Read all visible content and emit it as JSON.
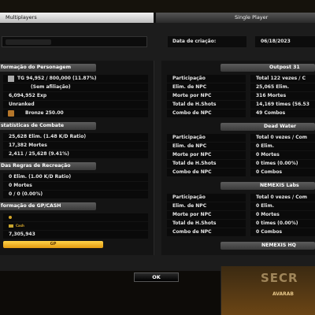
{
  "tabs": {
    "multiplayers": "Multiplayers",
    "single_player": "Single Player"
  },
  "profile": {
    "date_label": "Data de criação:",
    "date_value": "06/18/2023"
  },
  "personagem": {
    "title": "formação do Personagem",
    "rank_text": "TG  94,952 / 800,000 (11.87%)",
    "affiliation": "(Sem afiliação)",
    "exp": "6,094,952 Exp",
    "ranked": "Unranked",
    "bronze": "Bronze 250.00"
  },
  "combate": {
    "title": "statísticas de Combate",
    "rows": [
      "25,628 Elim. (1.48 K/D Ratio)",
      "17,382 Mortes",
      "2,411 / 25,628 (9.41%)"
    ]
  },
  "recreacao": {
    "title": "Das Regras de Recreação",
    "rows": [
      "0 Elim. (1.00 K/D Ratio)",
      "0 Mortes",
      "0 / 0 (0.00%)"
    ]
  },
  "gpcash": {
    "title": "formação de GP/CASH",
    "cash_label": "Cash",
    "gp": "7,305,943",
    "button": "GP"
  },
  "maps": [
    {
      "title": "Outpost 31",
      "rows": [
        {
          "label": "Participação",
          "value": "Total 122 vezes / C"
        },
        {
          "label": "Elim. de NPC",
          "value": "25,065 Elim."
        },
        {
          "label": "Morte por NPC",
          "value": "316 Mortes"
        },
        {
          "label": "Total de H.Shots",
          "value": "14,169 times (56.53"
        },
        {
          "label": "Combo de NPC",
          "value": "49 Combos"
        }
      ]
    },
    {
      "title": "Dead Water",
      "rows": [
        {
          "label": "Participação",
          "value": "Total 0 vezes / Com"
        },
        {
          "label": "Elim. de NPC",
          "value": "0 Elim."
        },
        {
          "label": "Morte por NPC",
          "value": "0 Mortes"
        },
        {
          "label": "Total de H.Shots",
          "value": "0 times (0.00%)"
        },
        {
          "label": "Combo de NPC",
          "value": "0 Combos"
        }
      ]
    },
    {
      "title": "NEMEXIS Labs",
      "rows": [
        {
          "label": "Participação",
          "value": "Total 0 vezes / Com"
        },
        {
          "label": "Elim. de NPC",
          "value": "0 Elim."
        },
        {
          "label": "Morte por NPC",
          "value": "0 Mortes"
        },
        {
          "label": "Total de H.Shots",
          "value": "0 times (0.00%)"
        },
        {
          "label": "Combo de NPC",
          "value": "0 Combos"
        }
      ]
    },
    {
      "title": "NEMEXIS HQ",
      "rows": []
    }
  ],
  "ok_button": "OK",
  "banner": {
    "title": "SECR",
    "subtitle": "AVARAB"
  },
  "icons": {
    "rank": "rank-insignia-icon",
    "bronze": "bronze-medal-icon",
    "gp": "coin-icon",
    "cash": "cash-icon"
  },
  "colors": {
    "gold_button": "#f2b325",
    "header_gray": "#4a4a4a",
    "tab_active": "#dcdcdc"
  }
}
